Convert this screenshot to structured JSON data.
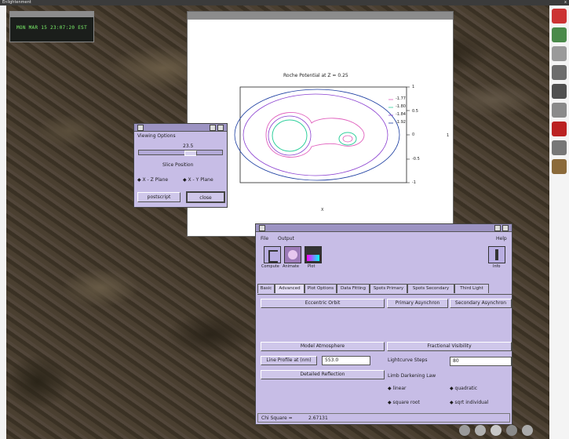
{
  "topbar": {
    "title": "Enlightenment",
    "close": "x"
  },
  "clock": {
    "text": "MON MAR 15 23:07:20 EST"
  },
  "plot": {
    "title": "Roche Potential at Z = 0.25",
    "y_ticks": [
      "1",
      "0.5",
      "0",
      "-0.5",
      "-1"
    ],
    "x_tick": "1",
    "x_label": "X",
    "legend": [
      "-1.77",
      "-1.80",
      "-1.84",
      "-1.92"
    ],
    "colors": {
      "c1": "#e05fbd",
      "c2": "#2fcf9c",
      "c3": "#8a3fd0",
      "c4": "#1a3ca0"
    }
  },
  "viewing": {
    "title": "Viewing Options",
    "slider_value": "23.5",
    "slice_label": "Slice Position",
    "radio_xz": "X - Z Plane",
    "radio_xy": "X - Y Plane",
    "postscript": "postscript",
    "close": "close"
  },
  "main": {
    "menu": {
      "file": "File",
      "output": "Output",
      "help": "Help"
    },
    "toolbar": {
      "compute": "Compute",
      "animate": "Animate",
      "plot": "Plot",
      "info": "Info"
    },
    "tabs": [
      "Basic",
      "Advanced",
      "Plot Options",
      "Data Fitting",
      "Spots Primary",
      "Spots Secondary",
      "Third Light"
    ],
    "eccentric_orbit": "Eccentric Orbit",
    "primary_asynchron": "Primary Asynchron",
    "secondary_asynchron": "Secondary Asynchron",
    "model_atmosphere": "Model Atmosphere",
    "fractional_visibility": "Fractional Visibility",
    "line_profile_btn": "Line Profile at (nm)",
    "line_profile_value": "553.0",
    "lightcurve_steps_label": "Lightcurve Steps",
    "lightcurve_steps_value": "80",
    "detailed_reflection": "Detailed Reflection",
    "limb_law_label": "Limb Darkening Law",
    "limb": {
      "linear": "linear",
      "quadratic": "quadratic",
      "square_root": "square root",
      "sqrt_individual": "sqrt individual"
    },
    "status_label": "Chi Square =",
    "status_value": "2.67131"
  }
}
